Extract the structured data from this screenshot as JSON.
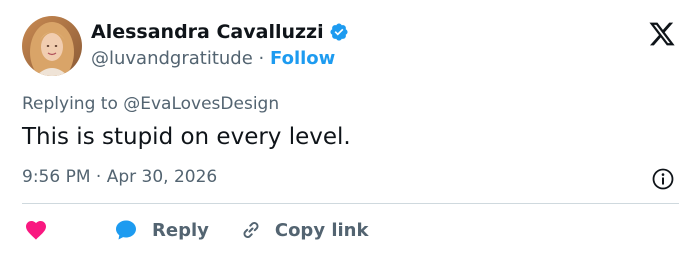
{
  "author": {
    "name": "Alessandra Cavalluzzi",
    "handle": "@luvandgratitude",
    "separator": "·",
    "follow_label": "Follow"
  },
  "tweet": {
    "reply_prefix": "Replying to ",
    "reply_to": "@EvaLovesDesign",
    "text": "This is stupid on every level.",
    "timestamp": "9:56 PM · Apr 30, 2026"
  },
  "actions": {
    "reply_label": "Reply",
    "copy_link_label": "Copy link"
  },
  "icons": {
    "verified": "verified-badge-icon",
    "logo": "x-logo-icon",
    "info": "info-icon",
    "like": "heart-icon",
    "reply": "speech-bubble-icon",
    "copy": "link-icon"
  },
  "colors": {
    "brand_blue": "#1d9bf0",
    "like_pink": "#f91880",
    "text_primary": "#0f1419",
    "text_secondary": "#536471",
    "divider": "#cfd9de"
  }
}
